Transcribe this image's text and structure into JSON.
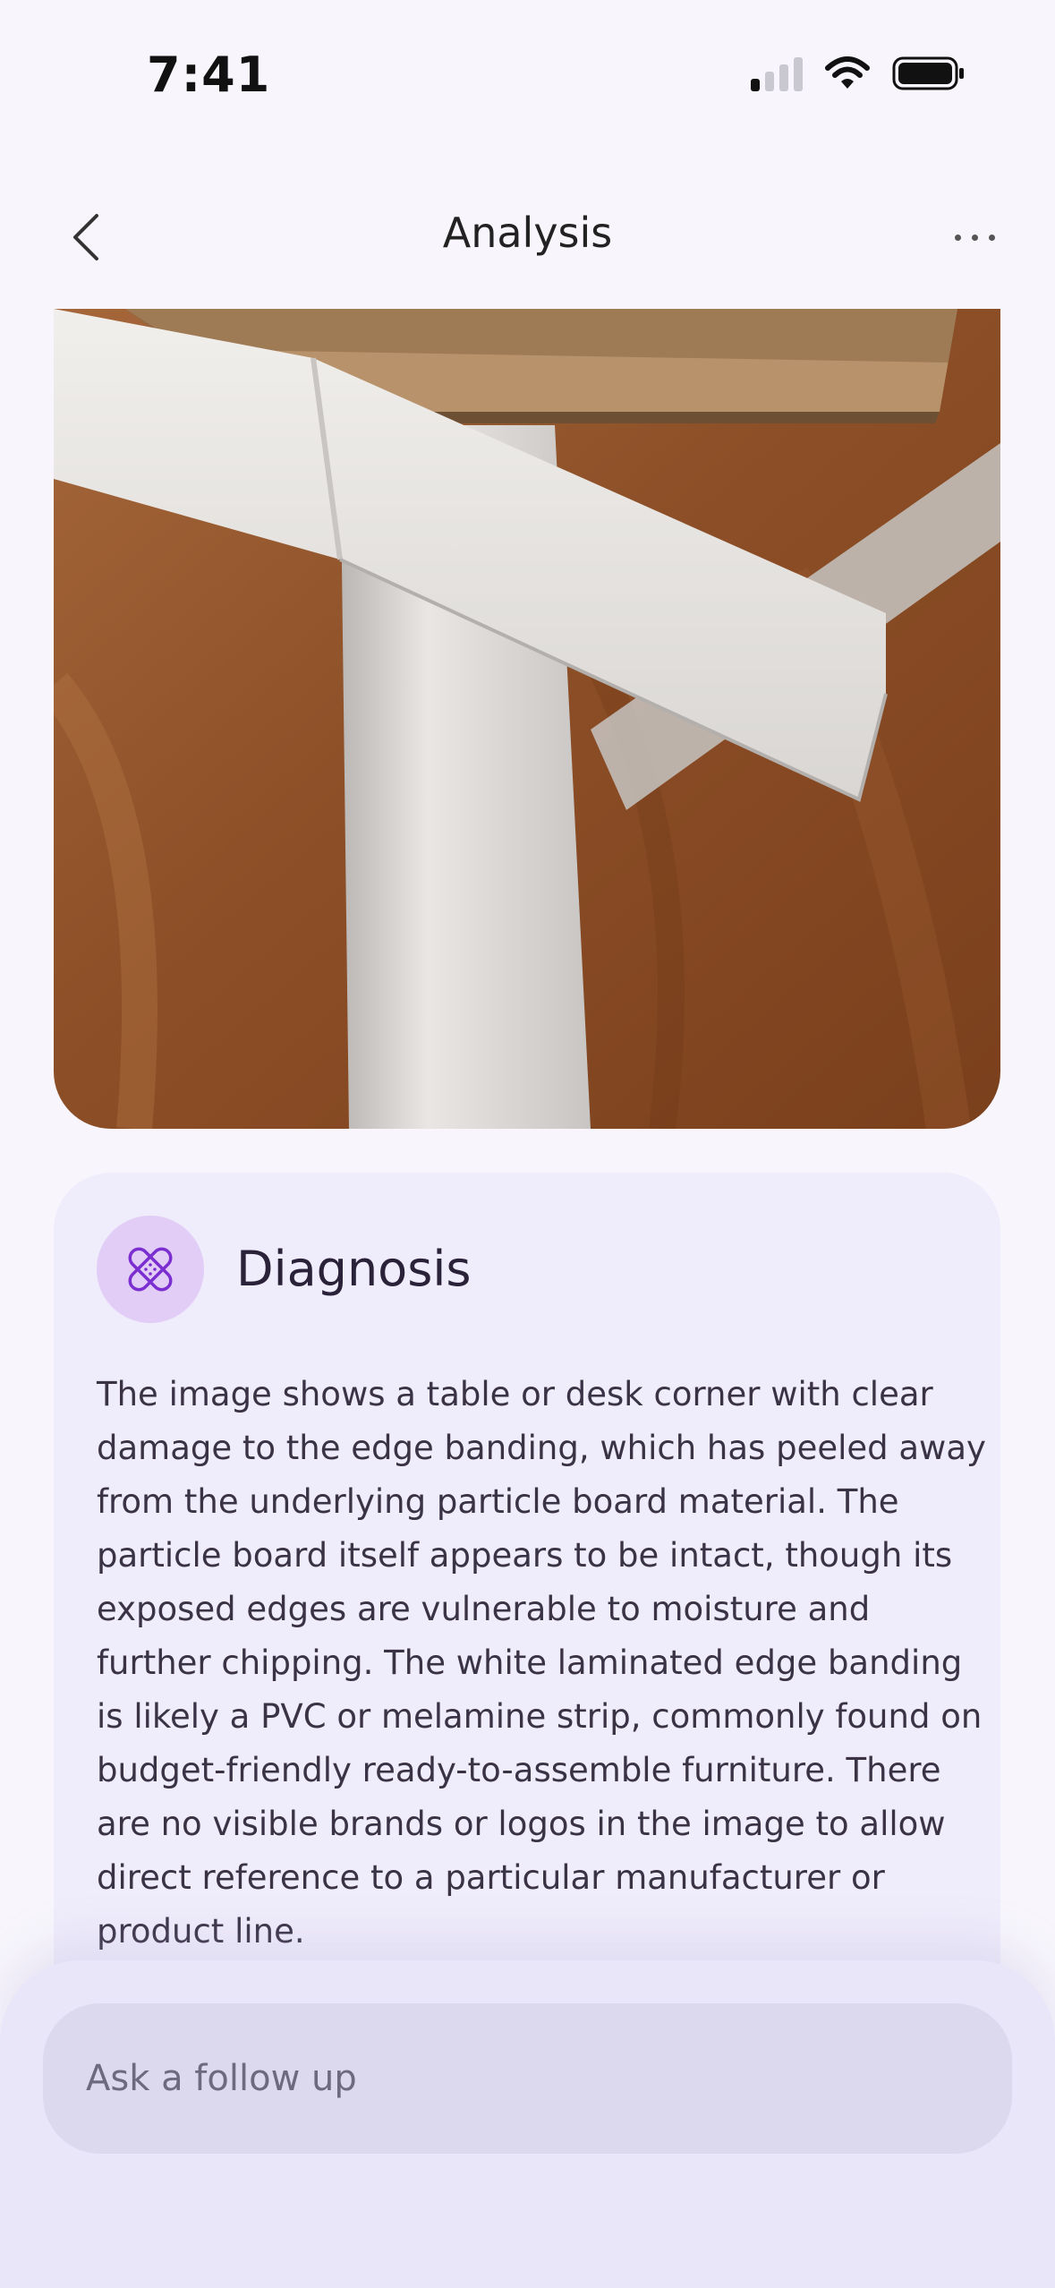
{
  "status_bar": {
    "time": "7:41",
    "signal_icon": "cellular-signal-icon",
    "wifi_icon": "wifi-icon",
    "battery_icon": "battery-icon"
  },
  "nav": {
    "title": "Analysis",
    "back_icon": "chevron-left-icon",
    "more_icon": "more-horizontal-icon"
  },
  "photo": {
    "subject": "peeling white edge banding on particle board table corner"
  },
  "diagnosis": {
    "icon": "bandage-icon",
    "title": "Diagnosis",
    "body": "The image shows a table or desk corner with clear damage to the edge banding, which has peeled away from the underlying particle board material. The particle board itself appears to be intact, though its exposed edges are vulnerable to moisture and further chipping. The white laminated edge banding is likely a PVC or melamine strip, commonly found on budget-friendly ready-to-assemble furniture. There are no visible brands or logos in the image to allow direct reference to a particular manufacturer or product line."
  },
  "follow_up": {
    "placeholder": "Ask a follow up"
  },
  "colors": {
    "background": "#f8f6fc",
    "card": "#efecfb",
    "icon_circle": "#e2cdf6",
    "icon_stroke": "#7b2fd0",
    "input_bg": "#dcd8ee"
  }
}
